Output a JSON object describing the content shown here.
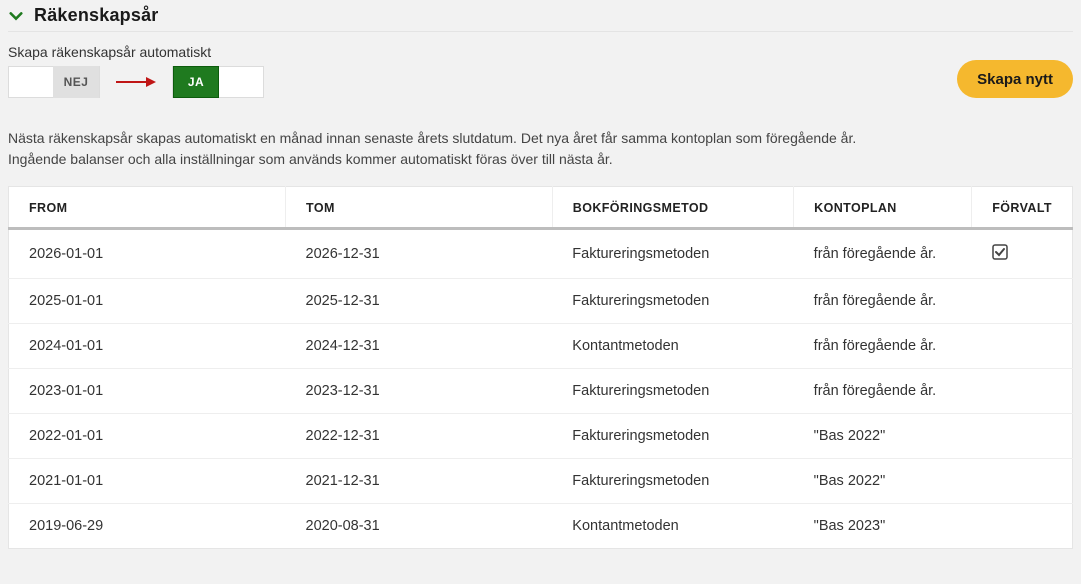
{
  "header": {
    "title": "Räkenskapsår"
  },
  "auto": {
    "label": "Skapa räkenskapsår automatiskt",
    "off": "NEJ",
    "on": "JA",
    "value": "JA"
  },
  "actions": {
    "create": "Skapa nytt"
  },
  "description": {
    "line1": "Nästa räkenskapsår skapas automatiskt en månad innan senaste årets slutdatum. Det nya året får samma kontoplan som föregående år.",
    "line2": "Ingående balanser och alla inställningar som används kommer automatiskt föras över till nästa år."
  },
  "table": {
    "headers": {
      "from": "FROM",
      "tom": "TOM",
      "method": "BOKFÖRINGSMETOD",
      "plan": "KONTOPLAN",
      "default": "FÖRVALT"
    },
    "rows": [
      {
        "from": "2026-01-01",
        "tom": "2026-12-31",
        "method": "Faktureringsmetoden",
        "plan": "från föregående år.",
        "default": true
      },
      {
        "from": "2025-01-01",
        "tom": "2025-12-31",
        "method": "Faktureringsmetoden",
        "plan": "från föregående år.",
        "default": false
      },
      {
        "from": "2024-01-01",
        "tom": "2024-12-31",
        "method": "Kontantmetoden",
        "plan": "från föregående år.",
        "default": false
      },
      {
        "from": "2023-01-01",
        "tom": "2023-12-31",
        "method": "Faktureringsmetoden",
        "plan": "från föregående år.",
        "default": false
      },
      {
        "from": "2022-01-01",
        "tom": "2022-12-31",
        "method": "Faktureringsmetoden",
        "plan": "\"Bas 2022\"",
        "default": false
      },
      {
        "from": "2021-01-01",
        "tom": "2021-12-31",
        "method": "Faktureringsmetoden",
        "plan": "\"Bas 2022\"",
        "default": false
      },
      {
        "from": "2019-06-29",
        "tom": "2020-08-31",
        "method": "Kontantmetoden",
        "plan": "\"Bas 2023\"",
        "default": false
      }
    ]
  }
}
